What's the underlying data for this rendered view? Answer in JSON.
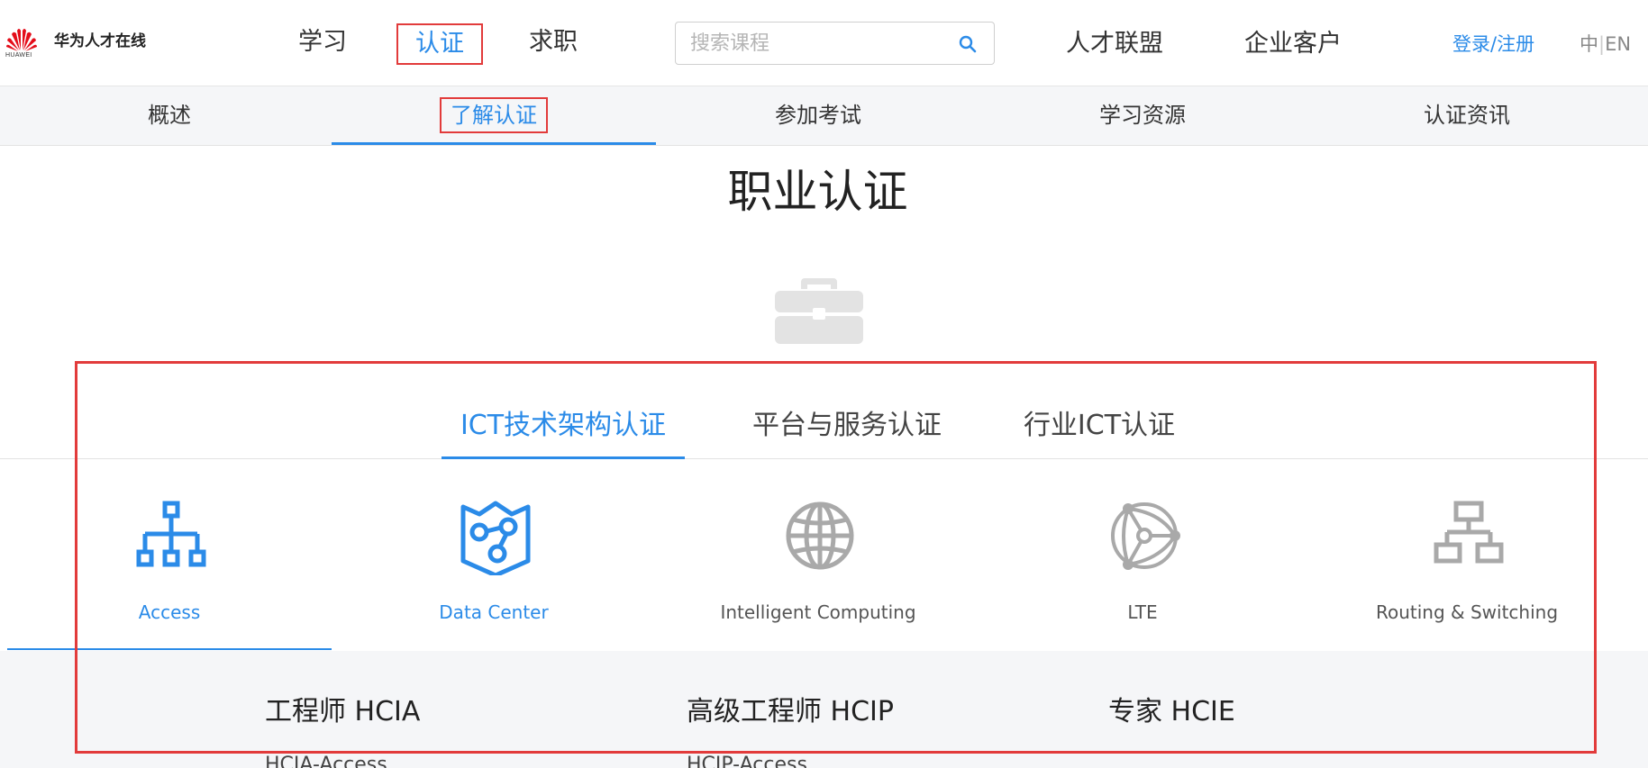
{
  "brand": {
    "wordmark": "HUAWEI",
    "site_name": "华为人才在线",
    "logo_color": "#e40e1a"
  },
  "main_nav": {
    "items": [
      {
        "label": "学习",
        "active": false
      },
      {
        "label": "认证",
        "active": true
      },
      {
        "label": "求职",
        "active": false
      }
    ]
  },
  "search": {
    "placeholder": "搜索课程",
    "value": "",
    "icon": "search-icon"
  },
  "header_links": {
    "talent_alliance": "人才联盟",
    "enterprise": "企业客户",
    "login": "登录/注册",
    "lang_zh": "中",
    "lang_sep": "|",
    "lang_en": "EN"
  },
  "sub_nav": {
    "items": [
      {
        "label": "概述",
        "active": false
      },
      {
        "label": "了解认证",
        "active": true
      },
      {
        "label": "参加考试",
        "active": false
      },
      {
        "label": "学习资源",
        "active": false
      },
      {
        "label": "认证资讯",
        "active": false
      }
    ]
  },
  "page": {
    "title": "职业认证",
    "hero_icon": "briefcase-icon"
  },
  "category_tabs": [
    {
      "label": "ICT技术架构认证",
      "active": true
    },
    {
      "label": "平台与服务认证",
      "active": false
    },
    {
      "label": "行业ICT认证",
      "active": false
    }
  ],
  "tech_items": [
    {
      "label": "Access",
      "icon": "hierarchy-icon",
      "active": true
    },
    {
      "label": "Data Center",
      "icon": "data-center-icon",
      "active": false
    },
    {
      "label": "Intelligent Computing",
      "icon": "globe-icon",
      "active": false
    },
    {
      "label": "LTE",
      "icon": "network-sphere-icon",
      "active": false
    },
    {
      "label": "Routing & Switching",
      "icon": "network-topology-icon",
      "active": false
    }
  ],
  "levels": [
    {
      "title": "工程师 HCIA",
      "sub": "HCIA-Access"
    },
    {
      "title": "高级工程师 HCIP",
      "sub": "HCIP-Access"
    },
    {
      "title": "专家 HCIE",
      "sub": ""
    }
  ],
  "colors": {
    "accent": "#2b8be8",
    "highlight": "#e23b3b",
    "icon_gray": "#a9a9a9",
    "subnav_bg": "#f5f6f8"
  }
}
